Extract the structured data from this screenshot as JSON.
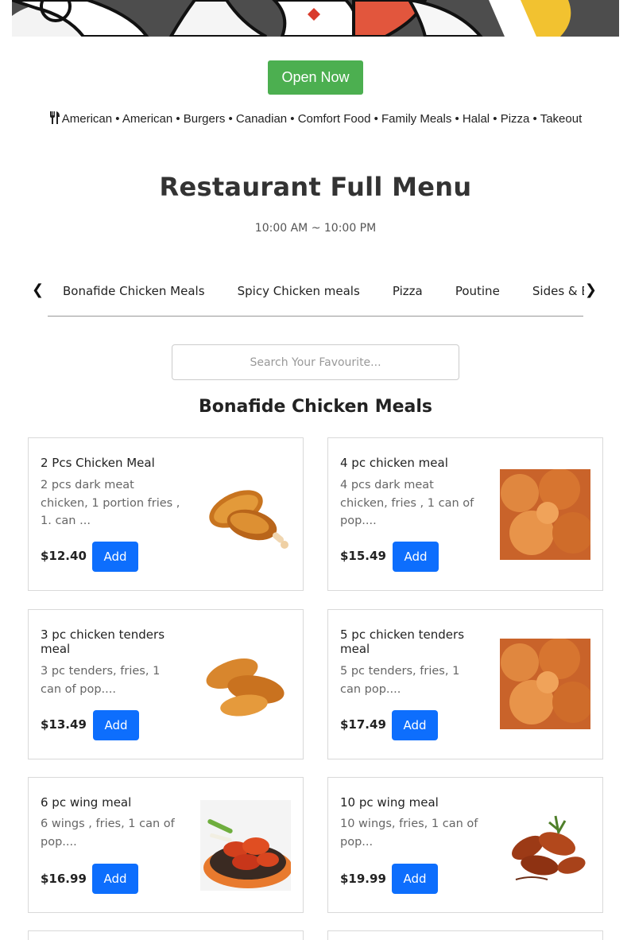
{
  "status_button": "Open Now",
  "cuisine_tags": "American • American • Burgers • Canadian • Comfort Food • Family Meals • Halal • Pizza • Takeout",
  "menu_title": "Restaurant Full Menu",
  "hours": "10:00 AM ~ 10:00 PM",
  "tabs": {
    "prev_arrow": "❮",
    "next_arrow": "❯",
    "items": [
      "Bonafide Chicken Meals",
      "Spicy Chicken meals",
      "Pizza",
      "Poutine",
      "Sides & Extras"
    ]
  },
  "search": {
    "placeholder": "Search Your Favourite..."
  },
  "section_title": "Bonafide Chicken Meals",
  "items": [
    {
      "name": "2 Pcs Chicken Meal",
      "description": "2 pcs dark meat chicken, 1 portion fries , 1. can ...",
      "price": "$12.40",
      "add_label": "Add",
      "image_icon": "fried-drumsticks"
    },
    {
      "name": "4 pc chicken meal",
      "description": "4 pcs dark meat chicken, fries , 1 can of pop....",
      "price": "$15.49",
      "add_label": "Add",
      "image_icon": "fried-chicken-pieces"
    },
    {
      "name": "3 pc chicken tenders meal",
      "description": "3 pc tenders, fries, 1 can of pop....",
      "price": "$13.49",
      "add_label": "Add",
      "image_icon": "chicken-tenders"
    },
    {
      "name": "5 pc chicken tenders meal",
      "description": "5 pc tenders, fries, 1 can pop....",
      "price": "$17.49",
      "add_label": "Add",
      "image_icon": "fried-chicken-pieces"
    },
    {
      "name": "6 pc wing meal",
      "description": "6 wings , fries, 1 can of pop....",
      "price": "$16.99",
      "add_label": "Add",
      "image_icon": "buffalo-wings-plate"
    },
    {
      "name": "10 pc wing meal",
      "description": "10 wings, fries, 1 can of pop...",
      "price": "$19.99",
      "add_label": "Add",
      "image_icon": "glazed-wings"
    }
  ],
  "colors": {
    "open_green": "#4caf50",
    "add_blue": "#0d6efd"
  }
}
